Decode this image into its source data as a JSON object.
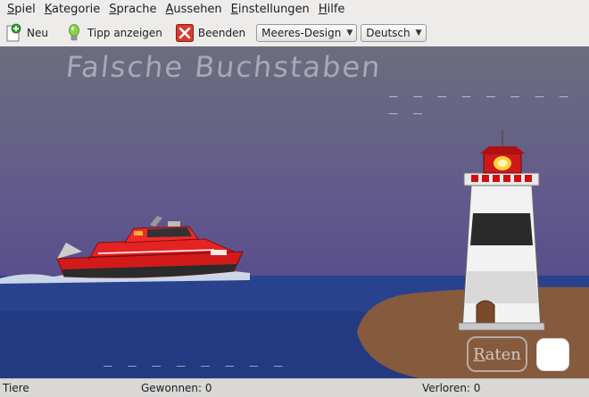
{
  "menubar": {
    "items": [
      {
        "mnemonic": "S",
        "rest": "piel"
      },
      {
        "mnemonic": "K",
        "rest": "ategorie"
      },
      {
        "mnemonic": "S",
        "rest": "prache"
      },
      {
        "mnemonic": "A",
        "rest": "ussehen"
      },
      {
        "mnemonic": "E",
        "rest": "instellungen"
      },
      {
        "mnemonic": "H",
        "rest": "ilfe"
      }
    ]
  },
  "toolbar": {
    "new_label": "Neu",
    "hint_label": "Tipp anzeigen",
    "quit_label": "Beenden",
    "theme_select": "Meeres-Design",
    "language_select": "Deutsch",
    "icons": {
      "new": "document-new-icon",
      "hint": "lightbulb-icon",
      "quit": "close-icon"
    }
  },
  "game": {
    "title": "Falsche Buchstaben",
    "wrong_letters_slots": "_ _ _ _ _ _ _ _ _ _",
    "word_slots": "_ _ _ _ _ _ _ _",
    "guess_mnemonic": "R",
    "guess_rest": "aten",
    "letter_value": ""
  },
  "statusbar": {
    "category": "Tiere",
    "won": "Gewonnen: 0",
    "lost": "Verloren: 0"
  },
  "colors": {
    "sky_top": "#6c6d7e",
    "sky_bottom": "#4e418c",
    "sea": "#2a3e88",
    "island": "#855a3d",
    "boat_hull": "#d21a1a"
  }
}
